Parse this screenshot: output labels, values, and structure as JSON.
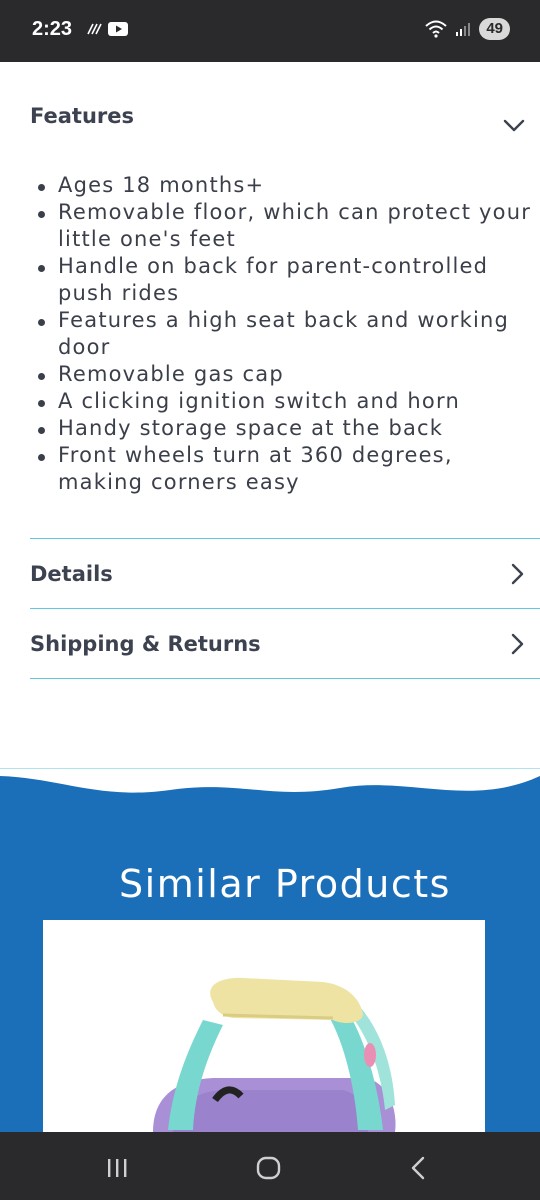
{
  "status_bar": {
    "time": "2:23",
    "battery": "49",
    "icons": [
      "data-saver-icon",
      "youtube-icon",
      "wifi-icon",
      "signal-icon"
    ]
  },
  "accordion": {
    "features": {
      "title": "Features",
      "items": [
        "Ages 18 months+",
        "Removable floor, which can protect your little one's feet",
        "Handle on back for parent-controlled push rides",
        "Features a high seat back and working door",
        "Removable gas cap",
        "A clicking ignition switch and horn",
        "Handy storage space at the back",
        "Front wheels turn at 360 degrees, making corners easy"
      ]
    },
    "details": {
      "title": "Details"
    },
    "shipping": {
      "title": "Shipping & Returns"
    }
  },
  "similar": {
    "title": "Similar Products"
  },
  "colors": {
    "accent_divider": "#5fc9df",
    "band_blue": "#1b6fb9",
    "text": "#3d4250"
  }
}
